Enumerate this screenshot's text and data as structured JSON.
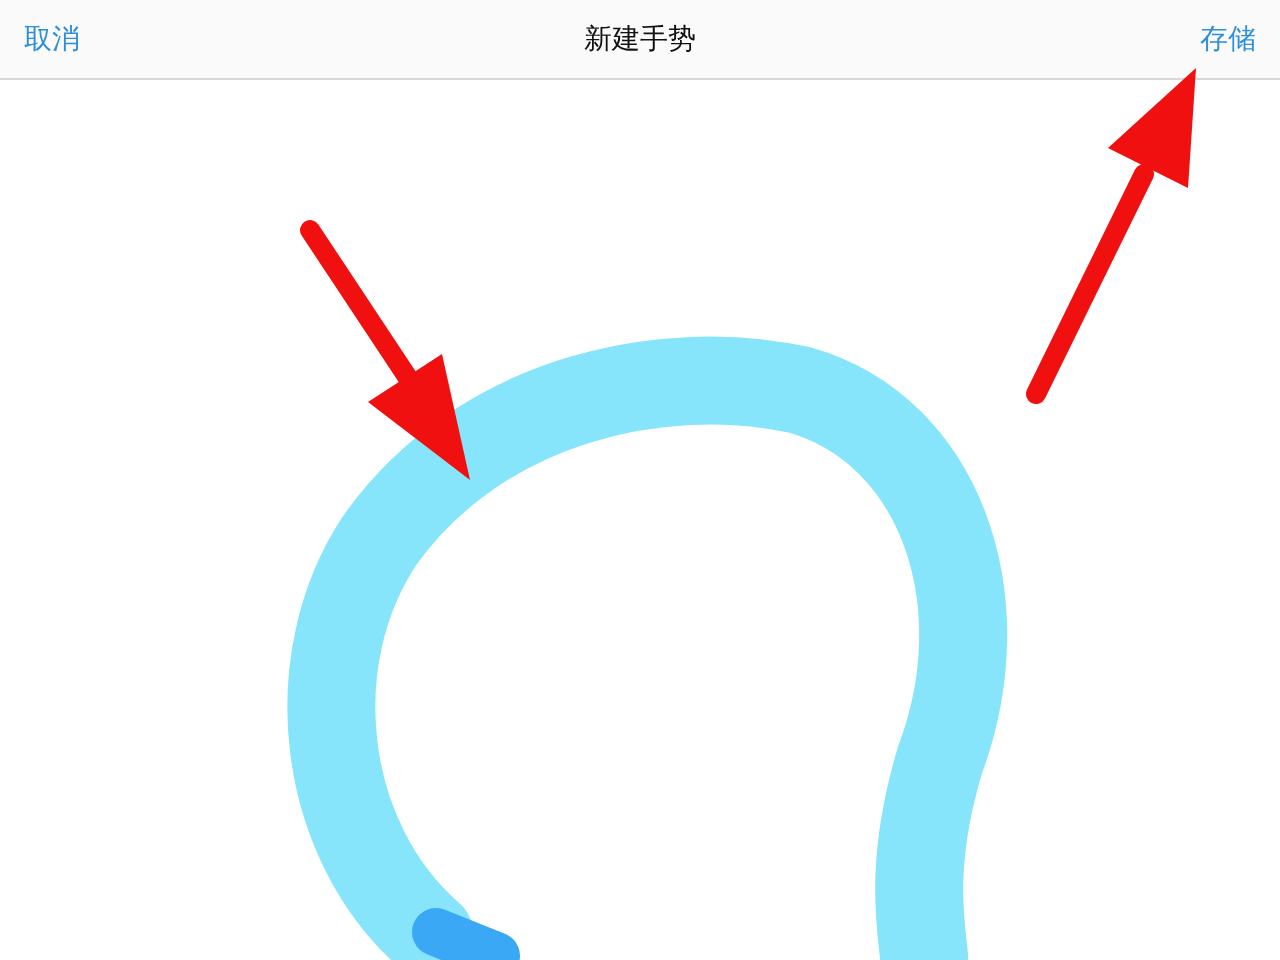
{
  "nav_bar": {
    "cancel": "取消",
    "title": "新建手势",
    "save": "存储"
  }
}
